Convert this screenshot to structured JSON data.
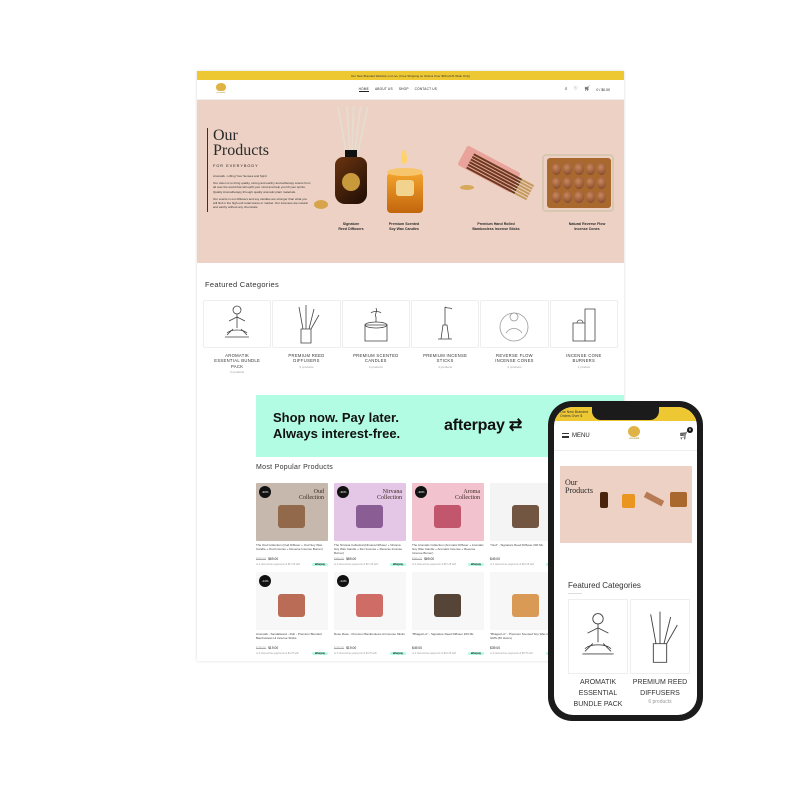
{
  "desktop": {
    "announcement": "Our New Branded Website not Live | Free Shipping on Orders Over $99 (AUS Wide Only)",
    "nav": [
      "HOME",
      "ABOUT US",
      "SHOP",
      "CONTACT US"
    ],
    "cart_total": "0 / $0.00",
    "logo_text": "aromatik",
    "hero": {
      "title_line1": "Our",
      "title_line2": "Products",
      "subtitle": "FOR EVERYBODY",
      "para1": "Aromatik - Lifting Your Senses and Spirit",
      "para2": "Our vision is to bring quality, strong and earthy aromatherapy scents from all over the world that will uplift your mind and help you lift your spirits. Quality Aromatherapy through quality aromatic plant materials.",
      "para3": "Our scents in our diffusers and soy candles are stronger than what you will find in the high end retail stores or market. Our incenses are natural and earthy without any chemicals.",
      "products": [
        {
          "line1": "Signature",
          "line2": "Reed Diffusers"
        },
        {
          "line1": "Premium Scented",
          "line2": "Soy Wax Candles"
        },
        {
          "line1": "Premium Hand Rolled",
          "line2": "Bambooless Incense Sticks"
        },
        {
          "line1": "Natural Reverse Flow",
          "line2": "Incense Cones"
        }
      ]
    },
    "featured_heading": "Featured Categories",
    "categories": [
      {
        "line1": "AROMATIK",
        "line2": "ESSENTIAL BUNDLE",
        "line3": "PACK",
        "count": "2 products"
      },
      {
        "line1": "PREMIUM REED",
        "line2": "DIFFUSERS",
        "line3": "",
        "count": "6 products"
      },
      {
        "line1": "PREMIUM SCENTED",
        "line2": "CANDLES",
        "line3": "",
        "count": "4 products"
      },
      {
        "line1": "PREMIUM INCENSE",
        "line2": "STICKS",
        "line3": "",
        "count": "4 products"
      },
      {
        "line1": "REVERSE FLOW",
        "line2": "INCENSE CONES",
        "line3": "",
        "count": "2 products"
      },
      {
        "line1": "INCENSE CONE",
        "line2": "BURNERS",
        "line3": "",
        "count": "1 product"
      }
    ],
    "afterpay": {
      "line1": "Shop now. Pay later.",
      "line2": "Always interest-free.",
      "logo": "afterpay"
    },
    "popular_heading": "Most Popular Products",
    "products": [
      {
        "badge": "-30%",
        "overlay1": "Oud",
        "overlay2": "Collection",
        "title": "The Oud Collection (Oud Diffuser + Oud Soy Wax Candle + Oud Incense + Reverse Incense Burner)",
        "old": "$99.00",
        "price": "$69.00",
        "ap": "or 4 interest-free payments of $17.25 with",
        "color1": "#c7b8ad",
        "color2": "#8a5a3a"
      },
      {
        "badge": "-30%",
        "overlay1": "Nirvana",
        "overlay2": "Collection",
        "title": "The Nirvana Collection(Nirvana Diffuser + Nirvana Soy Wax Candle + Zen Incense + Reverse Incense Burner)",
        "old": "$99.00",
        "price": "$69.00",
        "ap": "or 4 interest-free payments of $17.25 with",
        "color1": "#e4c6e6",
        "color2": "#7b4a86"
      },
      {
        "badge": "-30%",
        "overlay1": "Aroma",
        "overlay2": "Collection",
        "title": "The Aromatic Collection (Aromatic Diffuser + Aromatic Soy Wax Candle + Aromatic Incense + Reverse Incense Burner)",
        "old": "$99.00",
        "price": "$69.00",
        "ap": "or 4 interest-free payments of $17.25 with",
        "color1": "#f3c2cf",
        "color2": "#b8435c"
      },
      {
        "badge": "",
        "overlay1": "",
        "overlay2": "",
        "title": "\"Oud\" - Signature Reed Diffuser 200 ML",
        "old": "",
        "price": "$49.00",
        "ap": "or 4 interest-free payments of $12.25 with",
        "color1": "#f4f4f4",
        "color2": "#5a3a22"
      },
      {
        "badge": "-14%",
        "overlay1": "",
        "overlay2": "",
        "title": "Aromatik - Sandalwood - Ruh - Premium Blended Bambooless Hi Incense Sticks",
        "old": "$25.00",
        "price": "$19.00",
        "ap": "or 4 interest-free payments of $4.75 with",
        "color1": "#f7f7f7",
        "color2": "#b0533a"
      },
      {
        "badge": "-14%",
        "overlay1": "",
        "overlay2": "",
        "title": "Rose Rose - Premium Bambooless Hi Incense Sticks",
        "old": "$25.00",
        "price": "$19.00",
        "ap": "or 4 interest-free payments of $4.75 with",
        "color1": "#f7f7f7",
        "color2": "#c9544c"
      },
      {
        "badge": "",
        "overlay1": "",
        "overlay2": "",
        "title": "\"Bhagat Lic\" - Signature Reed Diffuser 200 ML",
        "old": "",
        "price": "$49.00",
        "ap": "or 4 interest-free payments of $12.25 with",
        "color1": "#f7f7f7",
        "color2": "#3a2415"
      },
      {
        "badge": "",
        "overlay1": "",
        "overlay2": "",
        "title": "\"Bhagat Lic\" - Premium Scented Soy Wax Candle 300 GMS (50 Hours)",
        "old": "",
        "price": "$39.00",
        "ap": "or 4 interest-free payments of $9.75 with",
        "color1": "#f7f7f7",
        "color2": "#d3893a"
      }
    ],
    "afterpay_pill": "afterpay"
  },
  "mobile": {
    "announcement1": "Our New Branded",
    "announcement2": "Orders Over $",
    "menu_label": "MENU",
    "cart_count": "0",
    "hero_title1": "Our",
    "hero_title2": "Products",
    "featured_heading": "Featured Categories",
    "categories": [
      {
        "line1": "AROMATIK",
        "line2": "ESSENTIAL",
        "line3": "BUNDLE PACK",
        "count": ""
      },
      {
        "line1": "PREMIUM REED",
        "line2": "DIFFUSERS",
        "line3": "",
        "count": "6 products"
      }
    ]
  },
  "colors": {
    "accent_yellow": "#eec832",
    "hero_pink": "#ecd1c4",
    "afterpay_mint": "#b2fce4"
  }
}
